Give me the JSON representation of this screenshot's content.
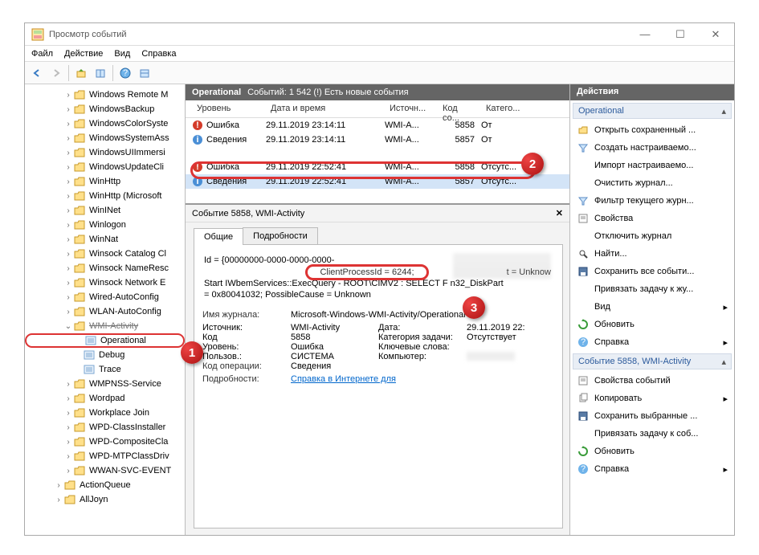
{
  "window": {
    "title": "Просмотр событий"
  },
  "menu": [
    "Файл",
    "Действие",
    "Вид",
    "Справка"
  ],
  "tree": [
    {
      "lvl": 4,
      "exp": ">",
      "ico": "folder",
      "label": "Windows Remote M"
    },
    {
      "lvl": 4,
      "exp": ">",
      "ico": "folder",
      "label": "WindowsBackup"
    },
    {
      "lvl": 4,
      "exp": ">",
      "ico": "folder",
      "label": "WindowsColorSyste"
    },
    {
      "lvl": 4,
      "exp": ">",
      "ico": "folder",
      "label": "WindowsSystemAss"
    },
    {
      "lvl": 4,
      "exp": ">",
      "ico": "folder",
      "label": "WindowsUIImmersi"
    },
    {
      "lvl": 4,
      "exp": ">",
      "ico": "folder",
      "label": "WindowsUpdateCli"
    },
    {
      "lvl": 4,
      "exp": ">",
      "ico": "folder",
      "label": "WinHttp"
    },
    {
      "lvl": 4,
      "exp": ">",
      "ico": "folder",
      "label": "WinHttp (Microsoft"
    },
    {
      "lvl": 4,
      "exp": ">",
      "ico": "folder",
      "label": "WinINet"
    },
    {
      "lvl": 4,
      "exp": ">",
      "ico": "folder",
      "label": "Winlogon"
    },
    {
      "lvl": 4,
      "exp": ">",
      "ico": "folder",
      "label": "WinNat"
    },
    {
      "lvl": 4,
      "exp": ">",
      "ico": "folder",
      "label": "Winsock Catalog Cl"
    },
    {
      "lvl": 4,
      "exp": ">",
      "ico": "folder",
      "label": "Winsock NameResc"
    },
    {
      "lvl": 4,
      "exp": ">",
      "ico": "folder",
      "label": "Winsock Network E"
    },
    {
      "lvl": 4,
      "exp": ">",
      "ico": "folder",
      "label": "Wired-AutoConfig"
    },
    {
      "lvl": 4,
      "exp": ">",
      "ico": "folder",
      "label": "WLAN-AutoConfig"
    },
    {
      "lvl": 4,
      "exp": "v",
      "ico": "folder",
      "label": "WMI-Activity",
      "struck": true
    },
    {
      "lvl": 5,
      "exp": " ",
      "ico": "log",
      "label": "Operational",
      "selected": true
    },
    {
      "lvl": 5,
      "exp": " ",
      "ico": "log",
      "label": "Debug"
    },
    {
      "lvl": 5,
      "exp": " ",
      "ico": "log",
      "label": "Trace"
    },
    {
      "lvl": 4,
      "exp": ">",
      "ico": "folder",
      "label": "WMPNSS-Service"
    },
    {
      "lvl": 4,
      "exp": ">",
      "ico": "folder",
      "label": "Wordpad"
    },
    {
      "lvl": 4,
      "exp": ">",
      "ico": "folder",
      "label": "Workplace Join"
    },
    {
      "lvl": 4,
      "exp": ">",
      "ico": "folder",
      "label": "WPD-ClassInstaller"
    },
    {
      "lvl": 4,
      "exp": ">",
      "ico": "folder",
      "label": "WPD-CompositeCla"
    },
    {
      "lvl": 4,
      "exp": ">",
      "ico": "folder",
      "label": "WPD-MTPClassDriv"
    },
    {
      "lvl": 4,
      "exp": ">",
      "ico": "folder",
      "label": "WWAN-SVC-EVENT"
    },
    {
      "lvl": 3,
      "exp": ">",
      "ico": "folder",
      "label": "ActionQueue"
    },
    {
      "lvl": 3,
      "exp": ">",
      "ico": "folder",
      "label": "AllJoyn"
    }
  ],
  "center_header": {
    "name": "Operational",
    "count": "Событий: 1 542 (!) Есть новые события"
  },
  "grid_cols": [
    "Уровень",
    "Дата и время",
    "Источн...",
    "Код со...",
    "Катего..."
  ],
  "events": [
    {
      "lvl": "Ошибка",
      "ico": "err",
      "dt": "29.11.2019 23:14:11",
      "src": "WMI-A...",
      "code": "5858",
      "cat": "От"
    },
    {
      "lvl": "Сведения",
      "ico": "info",
      "dt": "29.11.2019 23:14:11",
      "src": "WMI-A...",
      "code": "5857",
      "cat": "От"
    },
    {
      "lvl": "Ошибка",
      "ico": "err",
      "dt": "29.11.2019 22:52:41",
      "src": "WMI-A...",
      "code": "5858",
      "cat": "Отсутс...",
      "hl": true
    },
    {
      "lvl": "Сведения",
      "ico": "info",
      "dt": "29.11.2019 22:52:41",
      "src": "WMI-A...",
      "code": "5857",
      "cat": "Отсутс...",
      "sel": true
    }
  ],
  "detail": {
    "title": "Событие 5858, WMI-Activity",
    "tab_general": "Общие",
    "tab_details": "Подробности",
    "msg_l1": "Id = {00000000-0000-0000-0000-",
    "msg_cpid": "ClientProcessId = 6244;",
    "msg_tail": "t = Unknow",
    "msg_l2": "Start IWbemServices::ExecQuery - ROOT\\CIMV2 : SELECT       F          n32_DiskPart",
    "msg_l3": "= 0x80041032; PossibleCause = Unknown",
    "rows": {
      "log_name_k": "Имя журнала:",
      "log_name_v": "Microsoft-Windows-WMI-Activity/Operational",
      "source_k": "Источник:",
      "source_v": "WMI-Activity",
      "date_k": "Дата:",
      "date_v": "29.11.2019 22:",
      "code_k": "Код",
      "code_v": "5858",
      "taskcat_k": "Категория задачи:",
      "taskcat_v": "Отсутствует",
      "level_k": "Уровень:",
      "level_v": "Ошибка",
      "keywords_k": "Ключевые слова:",
      "user_k": "Пользов.:",
      "user_v": "СИСТЕМА",
      "computer_k": "Компьютер:",
      "opcode_k": "Код операции:",
      "opcode_v": "Сведения",
      "details_k": "Подробности:",
      "details_link": "Справка в Интернете для "
    }
  },
  "actions": {
    "title": "Действия",
    "sect1": "Operational",
    "items1": [
      {
        "ico": "open",
        "label": "Открыть сохраненный ..."
      },
      {
        "ico": "filter",
        "label": "Создать настраиваемо..."
      },
      {
        "ico": "blank",
        "label": "Импорт настраиваемо..."
      },
      {
        "ico": "blank",
        "label": "Очистить журнал..."
      },
      {
        "ico": "filter",
        "label": "Фильтр текущего журн..."
      },
      {
        "ico": "props",
        "label": "Свойства"
      },
      {
        "ico": "blank",
        "label": "Отключить журнал"
      },
      {
        "ico": "find",
        "label": "Найти..."
      },
      {
        "ico": "save",
        "label": "Сохранить все событи..."
      },
      {
        "ico": "blank",
        "label": "Привязать задачу к жу..."
      },
      {
        "ico": "blank",
        "label": "Вид",
        "arrow": true
      },
      {
        "ico": "refresh",
        "label": "Обновить"
      },
      {
        "ico": "help",
        "label": "Справка",
        "arrow": true
      }
    ],
    "sect2": "Событие 5858, WMI-Activity",
    "items2": [
      {
        "ico": "props",
        "label": "Свойства событий"
      },
      {
        "ico": "copy",
        "label": "Копировать",
        "arrow": true
      },
      {
        "ico": "save",
        "label": "Сохранить выбранные ..."
      },
      {
        "ico": "blank",
        "label": "Привязать задачу к соб..."
      },
      {
        "ico": "refresh",
        "label": "Обновить"
      },
      {
        "ico": "help",
        "label": "Справка",
        "arrow": true
      }
    ]
  }
}
